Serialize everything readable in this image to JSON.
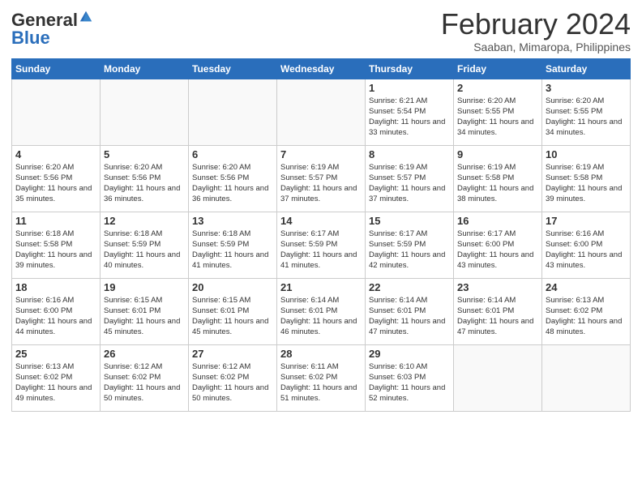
{
  "header": {
    "logo": {
      "general": "General",
      "blue": "Blue"
    },
    "title": "February 2024",
    "subtitle": "Saaban, Mimaropa, Philippines"
  },
  "calendar": {
    "days_of_week": [
      "Sunday",
      "Monday",
      "Tuesday",
      "Wednesday",
      "Thursday",
      "Friday",
      "Saturday"
    ],
    "weeks": [
      [
        {
          "day": "",
          "info": ""
        },
        {
          "day": "",
          "info": ""
        },
        {
          "day": "",
          "info": ""
        },
        {
          "day": "",
          "info": ""
        },
        {
          "day": "1",
          "info": "Sunrise: 6:21 AM\nSunset: 5:54 PM\nDaylight: 11 hours and 33 minutes."
        },
        {
          "day": "2",
          "info": "Sunrise: 6:20 AM\nSunset: 5:55 PM\nDaylight: 11 hours and 34 minutes."
        },
        {
          "day": "3",
          "info": "Sunrise: 6:20 AM\nSunset: 5:55 PM\nDaylight: 11 hours and 34 minutes."
        }
      ],
      [
        {
          "day": "4",
          "info": "Sunrise: 6:20 AM\nSunset: 5:56 PM\nDaylight: 11 hours and 35 minutes."
        },
        {
          "day": "5",
          "info": "Sunrise: 6:20 AM\nSunset: 5:56 PM\nDaylight: 11 hours and 36 minutes."
        },
        {
          "day": "6",
          "info": "Sunrise: 6:20 AM\nSunset: 5:56 PM\nDaylight: 11 hours and 36 minutes."
        },
        {
          "day": "7",
          "info": "Sunrise: 6:19 AM\nSunset: 5:57 PM\nDaylight: 11 hours and 37 minutes."
        },
        {
          "day": "8",
          "info": "Sunrise: 6:19 AM\nSunset: 5:57 PM\nDaylight: 11 hours and 37 minutes."
        },
        {
          "day": "9",
          "info": "Sunrise: 6:19 AM\nSunset: 5:58 PM\nDaylight: 11 hours and 38 minutes."
        },
        {
          "day": "10",
          "info": "Sunrise: 6:19 AM\nSunset: 5:58 PM\nDaylight: 11 hours and 39 minutes."
        }
      ],
      [
        {
          "day": "11",
          "info": "Sunrise: 6:18 AM\nSunset: 5:58 PM\nDaylight: 11 hours and 39 minutes."
        },
        {
          "day": "12",
          "info": "Sunrise: 6:18 AM\nSunset: 5:59 PM\nDaylight: 11 hours and 40 minutes."
        },
        {
          "day": "13",
          "info": "Sunrise: 6:18 AM\nSunset: 5:59 PM\nDaylight: 11 hours and 41 minutes."
        },
        {
          "day": "14",
          "info": "Sunrise: 6:17 AM\nSunset: 5:59 PM\nDaylight: 11 hours and 41 minutes."
        },
        {
          "day": "15",
          "info": "Sunrise: 6:17 AM\nSunset: 5:59 PM\nDaylight: 11 hours and 42 minutes."
        },
        {
          "day": "16",
          "info": "Sunrise: 6:17 AM\nSunset: 6:00 PM\nDaylight: 11 hours and 43 minutes."
        },
        {
          "day": "17",
          "info": "Sunrise: 6:16 AM\nSunset: 6:00 PM\nDaylight: 11 hours and 43 minutes."
        }
      ],
      [
        {
          "day": "18",
          "info": "Sunrise: 6:16 AM\nSunset: 6:00 PM\nDaylight: 11 hours and 44 minutes."
        },
        {
          "day": "19",
          "info": "Sunrise: 6:15 AM\nSunset: 6:01 PM\nDaylight: 11 hours and 45 minutes."
        },
        {
          "day": "20",
          "info": "Sunrise: 6:15 AM\nSunset: 6:01 PM\nDaylight: 11 hours and 45 minutes."
        },
        {
          "day": "21",
          "info": "Sunrise: 6:14 AM\nSunset: 6:01 PM\nDaylight: 11 hours and 46 minutes."
        },
        {
          "day": "22",
          "info": "Sunrise: 6:14 AM\nSunset: 6:01 PM\nDaylight: 11 hours and 47 minutes."
        },
        {
          "day": "23",
          "info": "Sunrise: 6:14 AM\nSunset: 6:01 PM\nDaylight: 11 hours and 47 minutes."
        },
        {
          "day": "24",
          "info": "Sunrise: 6:13 AM\nSunset: 6:02 PM\nDaylight: 11 hours and 48 minutes."
        }
      ],
      [
        {
          "day": "25",
          "info": "Sunrise: 6:13 AM\nSunset: 6:02 PM\nDaylight: 11 hours and 49 minutes."
        },
        {
          "day": "26",
          "info": "Sunrise: 6:12 AM\nSunset: 6:02 PM\nDaylight: 11 hours and 50 minutes."
        },
        {
          "day": "27",
          "info": "Sunrise: 6:12 AM\nSunset: 6:02 PM\nDaylight: 11 hours and 50 minutes."
        },
        {
          "day": "28",
          "info": "Sunrise: 6:11 AM\nSunset: 6:02 PM\nDaylight: 11 hours and 51 minutes."
        },
        {
          "day": "29",
          "info": "Sunrise: 6:10 AM\nSunset: 6:03 PM\nDaylight: 11 hours and 52 minutes."
        },
        {
          "day": "",
          "info": ""
        },
        {
          "day": "",
          "info": ""
        }
      ]
    ]
  }
}
